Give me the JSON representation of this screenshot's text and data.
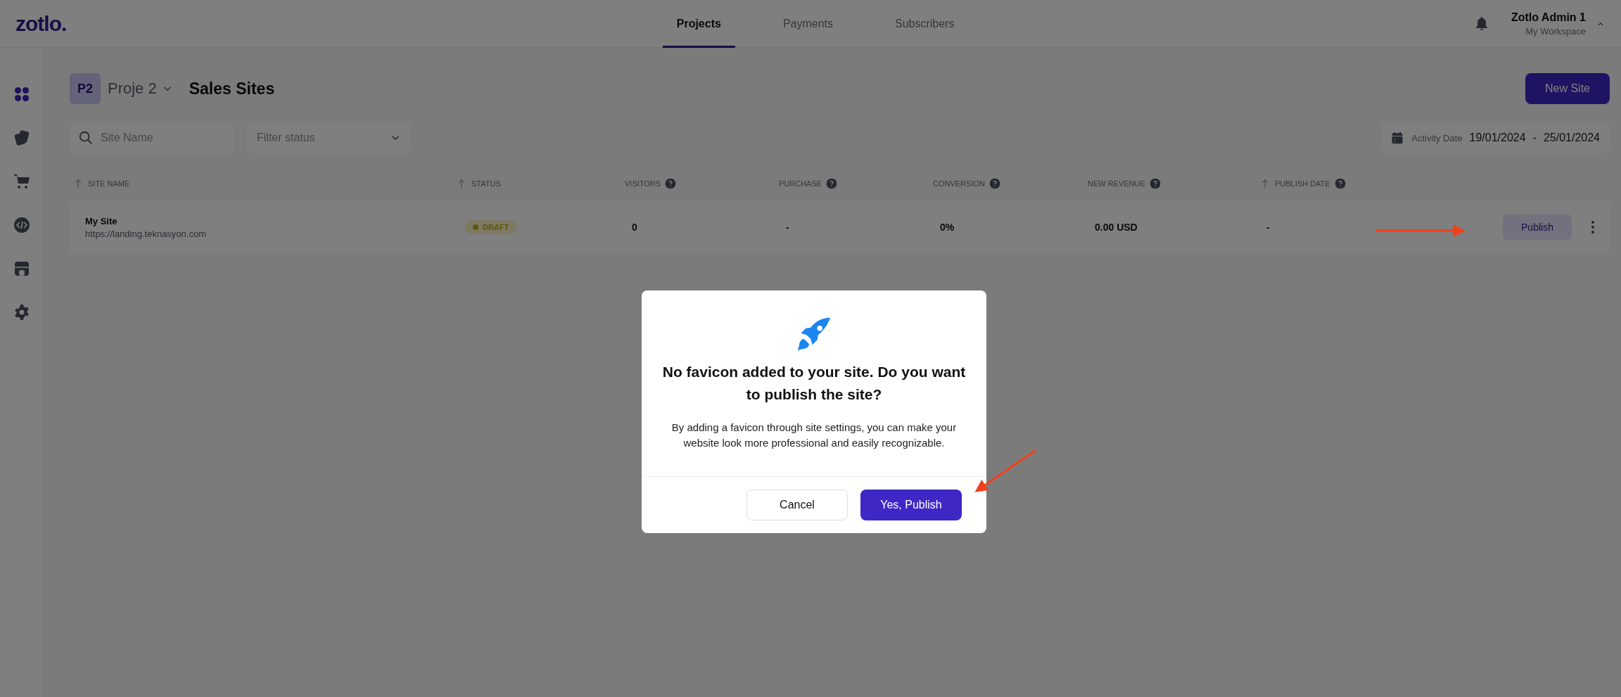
{
  "logo": "zotlo.",
  "tabs": [
    {
      "label": "Projects",
      "selected": true
    },
    {
      "label": "Payments",
      "selected": false
    },
    {
      "label": "Subscribers",
      "selected": false
    }
  ],
  "user": {
    "name": "Zotlo Admin 1",
    "workspace": "My Workspace"
  },
  "sidebar": {
    "items": [
      {
        "kind": "grid",
        "selected": true
      },
      {
        "kind": "pages",
        "selected": false
      },
      {
        "kind": "cart",
        "selected": false
      },
      {
        "kind": "code",
        "selected": false
      },
      {
        "kind": "store",
        "selected": false
      },
      {
        "kind": "settings",
        "selected": false
      }
    ]
  },
  "header": {
    "project_badge": "P2",
    "project": "Proje 2",
    "title": "Sales Sites",
    "new_button": "New Site"
  },
  "filters": {
    "search": {
      "placeholder": "Site Name"
    },
    "status": {
      "placeholder": "Filter status"
    },
    "date": {
      "label": "Activity Date",
      "from": "19/01/2024",
      "separator": "-",
      "to": "25/01/2024"
    }
  },
  "table": {
    "columns": [
      {
        "label": "SITE NAME",
        "sortable": true,
        "help": false
      },
      {
        "label": "STATUS",
        "sortable": true,
        "help": false
      },
      {
        "label": "VISITORS",
        "sortable": false,
        "help": true
      },
      {
        "label": "PURCHASE",
        "sortable": false,
        "help": true
      },
      {
        "label": "CONVERSION",
        "sortable": false,
        "help": true
      },
      {
        "label": "NEW REVENUE",
        "sortable": false,
        "help": true
      },
      {
        "label": "PUBLISH DATE",
        "sortable": true,
        "help": true
      }
    ],
    "rows": [
      {
        "name": "My Site",
        "url": "https://landing.teknasyon.com",
        "status": {
          "label": "DRAFT",
          "kind": "draft"
        },
        "visitors": "0",
        "purchase": "-",
        "conversion": "0%",
        "revenue": "0.00 USD",
        "publish_date": "-",
        "action": "Publish"
      }
    ]
  },
  "dialog": {
    "title": "No favicon added to your site. Do you want to publish the site?",
    "body": "By adding a favicon through site settings, you can make your website look more professional and easily recognizable.",
    "buttons": [
      {
        "label": "Cancel",
        "kind": "secondary"
      },
      {
        "label": "Yes, Publish",
        "kind": "primary"
      }
    ]
  }
}
